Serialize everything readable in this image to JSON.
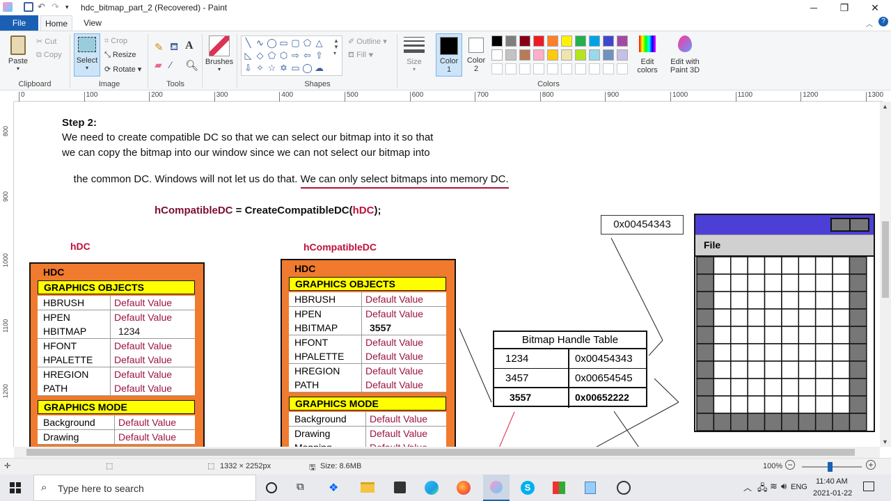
{
  "window": {
    "title": "hdc_bitmap_part_2 (Recovered) - Paint",
    "minimize": "─",
    "maximize": "❐",
    "close": "✕"
  },
  "tabs": {
    "file": "File",
    "home": "Home",
    "view": "View"
  },
  "ribbon": {
    "clipboard": {
      "group": "Clipboard",
      "paste": "Paste",
      "cut": "Cut",
      "copy": "Copy"
    },
    "image": {
      "group": "Image",
      "select": "Select",
      "crop": "Crop",
      "resize": "Resize",
      "rotate": "Rotate"
    },
    "tools": {
      "group": "Tools"
    },
    "brushes": "Brushes",
    "shapes": {
      "group": "Shapes",
      "outline": "Outline",
      "fill": "Fill"
    },
    "size": "Size",
    "color1": "Color\n1",
    "color2": "Color\n2",
    "colors": {
      "group": "Colors",
      "edit": "Edit\ncolors",
      "paint3d": "Edit with\nPaint 3D",
      "row1": [
        "#000000",
        "#7f7f7f",
        "#880015",
        "#ed1c24",
        "#ff7f27",
        "#fff200",
        "#22b14c",
        "#00a2e8",
        "#3f48cc",
        "#a349a4"
      ],
      "row2": [
        "#ffffff",
        "#c3c3c3",
        "#b97a57",
        "#ffaec9",
        "#ffc90e",
        "#efe4b0",
        "#b5e61d",
        "#99d9ea",
        "#7092be",
        "#c8bfe7"
      ]
    }
  },
  "ruler": {
    "h": [
      "0",
      "100",
      "200",
      "300",
      "400",
      "500",
      "600",
      "700",
      "800",
      "900",
      "1000",
      "1100",
      "1200",
      "1300"
    ],
    "v": [
      "800",
      "900",
      "1000",
      "1100",
      "1200"
    ]
  },
  "doc": {
    "step_title": "Step 2:",
    "para1": "We need to create compatible DC so that we can select our bitmap into it so that",
    "para2": "we can copy the bitmap into our window since we can not select our bitmap into",
    "para3a": "the common DC. Windows will not let us do that. ",
    "para3b": "We can only select bitmaps into memory DC.",
    "code_a": "hCompatibleDC",
    "code_b": " = CreateCompatibleDC(",
    "code_c": "hDC",
    "code_d": ");",
    "handle_box": "0x00454343",
    "left": {
      "label": "hDC",
      "header": "HDC",
      "gobj": "GRAPHICS OBJECTS",
      "gmode": "GRAPHICS MODE",
      "rows": [
        [
          "HBRUSH",
          "Default Value"
        ],
        [
          "HPEN",
          "Default Value"
        ],
        [
          "HBITMAP",
          "1234"
        ],
        [
          "HFONT",
          "Default Value"
        ],
        [
          "HPALETTE",
          "Default Value"
        ],
        [
          "HREGION",
          "Default Value"
        ],
        [
          "PATH",
          "Default Value"
        ]
      ],
      "mode_rows": [
        [
          "Background",
          "Default Value"
        ],
        [
          "Drawing",
          "Default Value"
        ]
      ]
    },
    "right": {
      "label": "hCompatibleDC",
      "header": "HDC",
      "gobj": "GRAPHICS OBJECTS",
      "gmode": "GRAPHICS MODE",
      "rows": [
        [
          "HBRUSH",
          "Default Value"
        ],
        [
          "HPEN",
          "Default Value"
        ],
        [
          "HBITMAP",
          "3557"
        ],
        [
          "HFONT",
          "Default Value"
        ],
        [
          "HPALETTE",
          "Default Value"
        ],
        [
          "HREGION",
          "Default Value"
        ],
        [
          "PATH",
          "Default Value"
        ]
      ],
      "mode_rows": [
        [
          "Background",
          "Default Value"
        ],
        [
          "Drawing",
          "Default Value"
        ],
        [
          "Mapping",
          "Default Value"
        ]
      ]
    },
    "bht": {
      "title": "Bitmap Handle Table",
      "rows": [
        [
          "1234",
          "0x00454343"
        ],
        [
          "3457",
          "0x00654545"
        ],
        [
          "3557",
          "0x00652222"
        ]
      ]
    },
    "win": {
      "menu": "File"
    }
  },
  "status": {
    "dims": "1332 × 2252px",
    "size": "Size: 8.6MB",
    "zoom": "100%"
  },
  "taskbar": {
    "search": "Type here to search",
    "lang": "ENG",
    "time": "11:40 AM",
    "date": "2021-01-22"
  }
}
